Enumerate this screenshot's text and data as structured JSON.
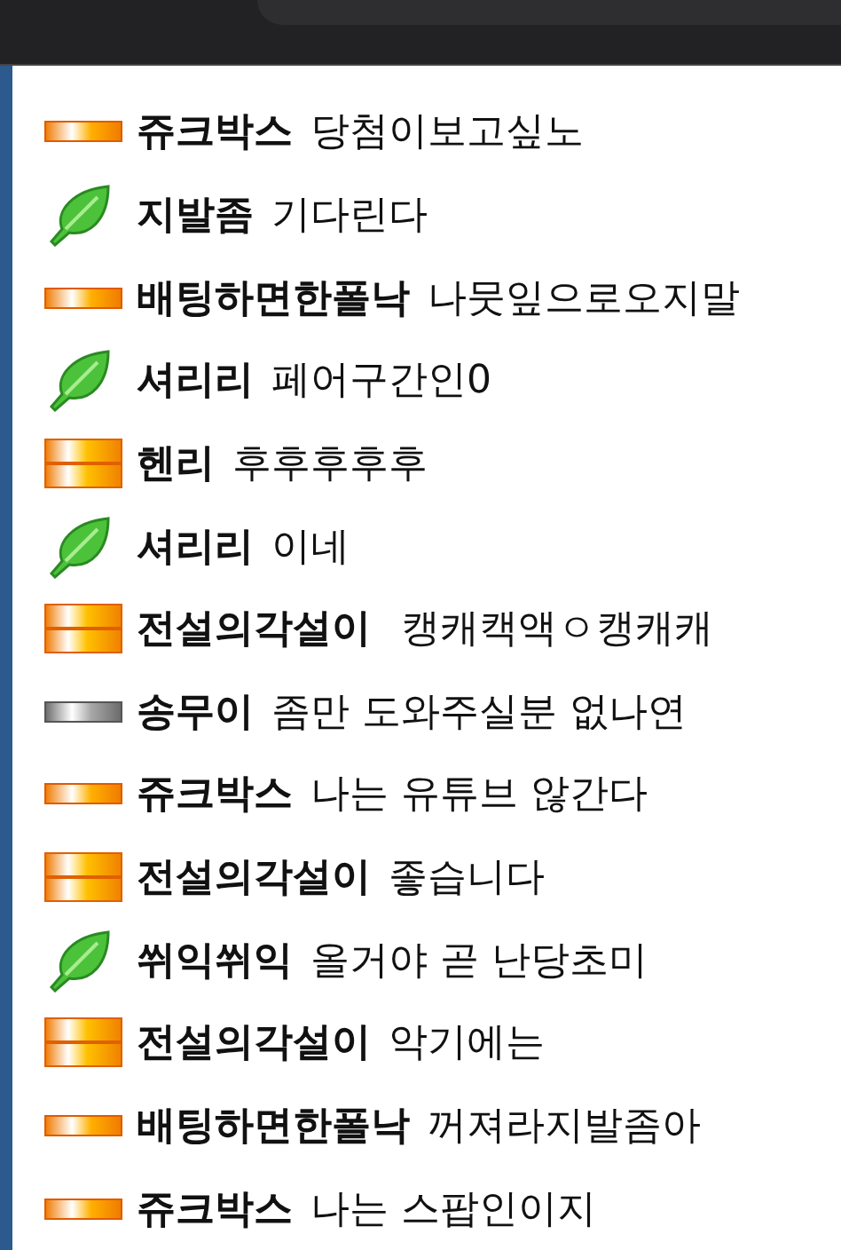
{
  "messages": [
    {
      "kind": "bar",
      "name": "쥬크박스",
      "text": "당첨이보고싶노"
    },
    {
      "kind": "leaf",
      "name": "지발좀",
      "text": "기다린다"
    },
    {
      "kind": "bar",
      "name": "배팅하면한폴낙",
      "text": "나뭇잎으로오지말"
    },
    {
      "kind": "leaf",
      "name": "셔리리",
      "text": "페어구간인0"
    },
    {
      "kind": "block",
      "name": "헨리",
      "text": "후후후후후"
    },
    {
      "kind": "leaf",
      "name": "셔리리",
      "text": "이네"
    },
    {
      "kind": "block",
      "name": "전설의각설이",
      "text": " 캥캐캑액ㅇ캥캐캐"
    },
    {
      "kind": "silver",
      "name": "송무이",
      "text": "좀만 도와주실분 없나연"
    },
    {
      "kind": "bar",
      "name": "쥬크박스",
      "text": "나는 유튜브 않간다"
    },
    {
      "kind": "block",
      "name": "전설의각설이",
      "text": "좋습니다"
    },
    {
      "kind": "leaf",
      "name": "쒸익쒸익",
      "text": "올거야 곧 난당초미"
    },
    {
      "kind": "block",
      "name": "전설의각설이",
      "text": "악기에는"
    },
    {
      "kind": "bar",
      "name": "배팅하면한폴낙",
      "text": "꺼져라지발좀아"
    },
    {
      "kind": "bar",
      "name": "쥬크박스",
      "text": "나는 스팝인이지"
    }
  ]
}
